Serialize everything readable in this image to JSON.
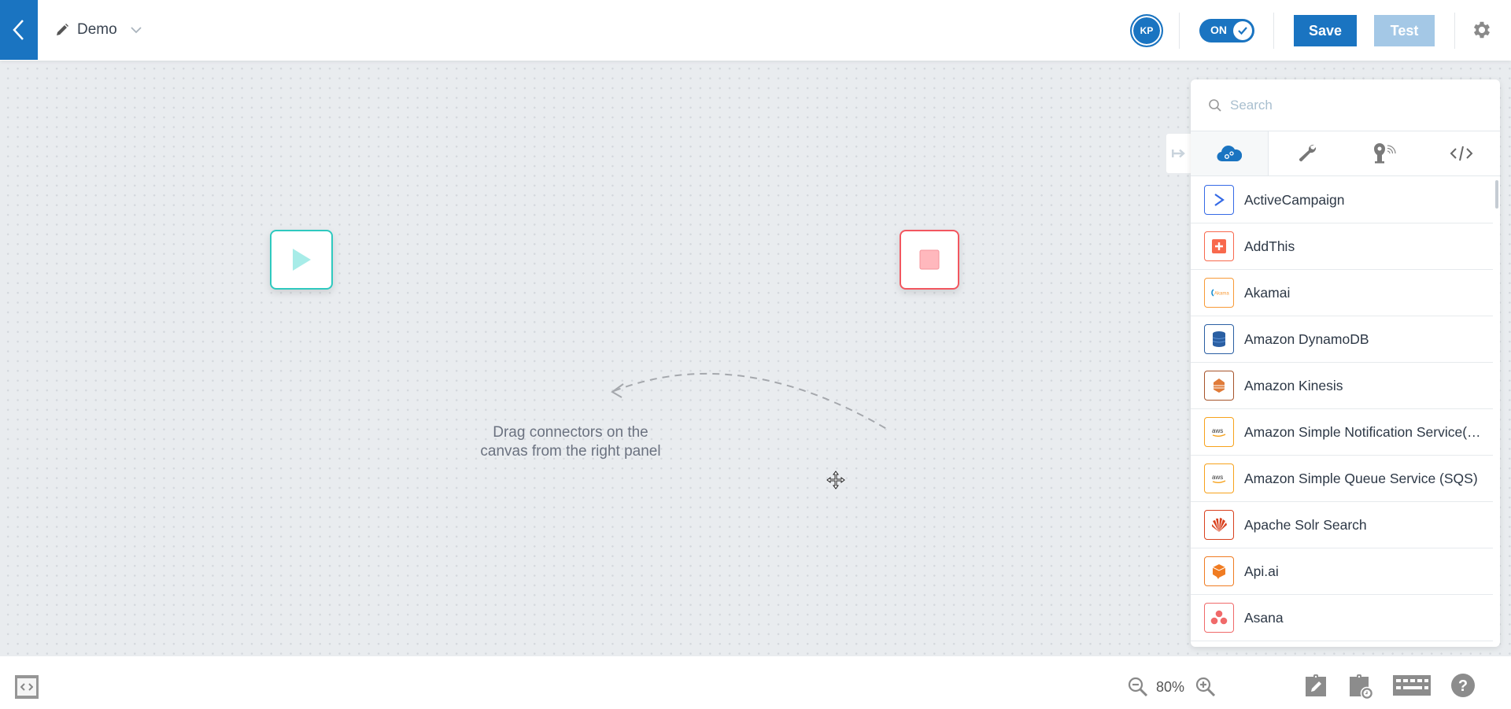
{
  "header": {
    "back_icon": "chevron-left-icon",
    "title": "Demo",
    "edit_icon": "pencil-icon",
    "dropdown_icon": "chevron-down-icon",
    "avatar_initials": "KP",
    "toggle_label": "ON",
    "toggle_state": true,
    "save_label": "Save",
    "test_label": "Test",
    "settings_icon": "gear-icon",
    "accent_color": "#1a74c1"
  },
  "canvas": {
    "start_node_icon": "play-icon",
    "stop_node_icon": "stop-icon",
    "hint_line1": "Drag connectors on the",
    "hint_line2": "canvas from the right panel",
    "start_color": "#2ec9bf",
    "stop_color": "#f2565f"
  },
  "panel": {
    "search_placeholder": "Search",
    "search_value": "",
    "tabs": [
      {
        "name": "connectors",
        "icon": "cloud-gears-icon",
        "active": true
      },
      {
        "name": "tools",
        "icon": "wrench-icon",
        "active": false
      },
      {
        "name": "iot",
        "icon": "iot-sensor-icon",
        "active": false
      },
      {
        "name": "code",
        "icon": "code-icon",
        "active": false
      }
    ],
    "items": [
      {
        "label": "ActiveCampaign",
        "icon": "activecampaign-logo",
        "color": "#356ae6"
      },
      {
        "label": "AddThis",
        "icon": "addthis-logo",
        "color": "#f8694d"
      },
      {
        "label": "Akamai",
        "icon": "akamai-logo",
        "color": "#f89a36"
      },
      {
        "label": "Amazon DynamoDB",
        "icon": "dynamodb-logo",
        "color": "#2a5fa3"
      },
      {
        "label": "Amazon Kinesis",
        "icon": "kinesis-logo",
        "color": "#a6532a"
      },
      {
        "label": "Amazon Simple Notification Service(SNS)",
        "icon": "aws-logo",
        "color": "#f7a21b"
      },
      {
        "label": "Amazon Simple Queue Service (SQS)",
        "icon": "aws-logo",
        "color": "#f7a21b"
      },
      {
        "label": "Apache Solr Search",
        "icon": "solr-logo",
        "color": "#d9411e"
      },
      {
        "label": "Api.ai",
        "icon": "apiai-logo",
        "color": "#f07c22"
      },
      {
        "label": "Asana",
        "icon": "asana-logo",
        "color": "#f06a6a"
      }
    ]
  },
  "footer": {
    "code_view_icon": "code-view-icon",
    "zoom_out_icon": "zoom-out-icon",
    "zoom_level": "80%",
    "zoom_in_icon": "zoom-in-icon",
    "notes_icon": "clipboard-edit-icon",
    "history_icon": "clipboard-history-icon",
    "keyboard_icon": "keyboard-icon",
    "help_icon": "help-icon"
  }
}
